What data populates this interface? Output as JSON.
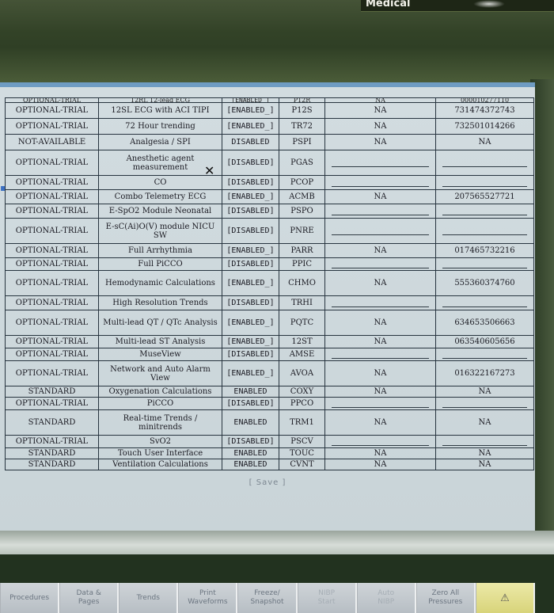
{
  "device": {
    "brand": "Medical"
  },
  "table": {
    "top_clipped": {
      "license": "OPTIONAL-TRIAL",
      "name": "12RL 12-lead ECG",
      "status": "[ENABLED_]",
      "code": "P12R",
      "na": "NA",
      "key": "000010277110"
    },
    "rows": [
      {
        "license": "OPTIONAL-TRIAL",
        "name": "12SL ECG with ACI TIPI",
        "status": "[ENABLED_]",
        "code": "P12S",
        "na": "NA",
        "key": "731474372743"
      },
      {
        "license": "OPTIONAL-TRIAL",
        "name": "72 Hour trending",
        "status": "[ENABLED_]",
        "code": "TR72",
        "na": "NA",
        "key": "732501014266"
      },
      {
        "license": "NOT-AVAILABLE",
        "name": "Analgesia / SPI",
        "status": "DISABLED",
        "code": "PSPI",
        "na": "NA",
        "key": "NA"
      },
      {
        "license": "OPTIONAL-TRIAL",
        "name": "Anesthetic agent measurement",
        "status": "[DISABLED]",
        "code": "PGAS",
        "na": "",
        "key": ""
      },
      {
        "license": "OPTIONAL-TRIAL",
        "name": "CO",
        "status": "[DISABLED]",
        "code": "PCOP",
        "na": "",
        "key": ""
      },
      {
        "license": "OPTIONAL-TRIAL",
        "name": "Combo Telemetry ECG",
        "status": "[ENABLED_]",
        "code": "ACMB",
        "na": "NA",
        "key": "207565527721"
      },
      {
        "license": "OPTIONAL-TRIAL",
        "name": "E-SpO2 Module Neonatal",
        "status": "[DISABLED]",
        "code": "PSPO",
        "na": "",
        "key": ""
      },
      {
        "license": "OPTIONAL-TRIAL",
        "name": "E-sC(Ai)O(V) module NICU SW",
        "status": "[DISABLED]",
        "code": "PNRE",
        "na": "",
        "key": ""
      },
      {
        "license": "OPTIONAL-TRIAL",
        "name": "Full Arrhythmia",
        "status": "[ENABLED_]",
        "code": "PARR",
        "na": "NA",
        "key": "017465732216"
      },
      {
        "license": "OPTIONAL-TRIAL",
        "name": "Full PiCCO",
        "status": "[DISABLED]",
        "code": "PPIC",
        "na": "",
        "key": ""
      },
      {
        "license": "OPTIONAL-TRIAL",
        "name": "Hemodynamic Calculations",
        "status": "[ENABLED_]",
        "code": "CHMO",
        "na": "NA",
        "key": "555360374760"
      },
      {
        "license": "OPTIONAL-TRIAL",
        "name": "High Resolution Trends",
        "status": "[DISABLED]",
        "code": "TRHI",
        "na": "",
        "key": ""
      },
      {
        "license": "OPTIONAL-TRIAL",
        "name": "Multi-lead QT / QTc Analysis",
        "status": "[ENABLED_]",
        "code": "PQTC",
        "na": "NA",
        "key": "634653506663"
      },
      {
        "license": "OPTIONAL-TRIAL",
        "name": "Multi-lead ST Analysis",
        "status": "[ENABLED_]",
        "code": "12ST",
        "na": "NA",
        "key": "063540605656"
      },
      {
        "license": "OPTIONAL-TRIAL",
        "name": "MuseView",
        "status": "[DISABLED]",
        "code": "AMSE",
        "na": "",
        "key": ""
      },
      {
        "license": "OPTIONAL-TRIAL",
        "name": "Network and Auto Alarm View",
        "status": "[ENABLED_]",
        "code": "AVOA",
        "na": "NA",
        "key": "016322167273"
      },
      {
        "license": "STANDARD",
        "name": "Oxygenation Calculations",
        "status": "ENABLED",
        "code": "COXY",
        "na": "NA",
        "key": "NA"
      },
      {
        "license": "OPTIONAL-TRIAL",
        "name": "PiCCO",
        "status": "[DISABLED]",
        "code": "PPCO",
        "na": "",
        "key": ""
      },
      {
        "license": "STANDARD",
        "name": "Real-time Trends / minitrends",
        "status": "ENABLED",
        "code": "TRM1",
        "na": "NA",
        "key": "NA"
      },
      {
        "license": "OPTIONAL-TRIAL",
        "name": "SvO2",
        "status": "[DISABLED]",
        "code": "PSCV",
        "na": "",
        "key": ""
      },
      {
        "license": "STANDARD",
        "name": "Touch User Interface",
        "status": "ENABLED",
        "code": "TOUC",
        "na": "NA",
        "key": "NA"
      },
      {
        "license": "STANDARD",
        "name": "Ventilation Calculations",
        "status": "ENABLED",
        "code": "CVNT",
        "na": "NA",
        "key": "NA"
      }
    ]
  },
  "save_label": "[ Save ]",
  "buttons": [
    {
      "label": "Procedures",
      "state": "normal"
    },
    {
      "label": "Data &\nPages",
      "state": "normal"
    },
    {
      "label": "Trends",
      "state": "normal"
    },
    {
      "label": "Print\nWaveforms",
      "state": "normal"
    },
    {
      "label": "Freeze/\nSnapshot",
      "state": "normal"
    },
    {
      "label": "NIBP\nStart",
      "state": "dim"
    },
    {
      "label": "Auto\nNIBP",
      "state": "dim"
    },
    {
      "label": "Zero All\nPressures",
      "state": "normal"
    },
    {
      "label": "alarm-icon",
      "state": "alarm"
    }
  ]
}
